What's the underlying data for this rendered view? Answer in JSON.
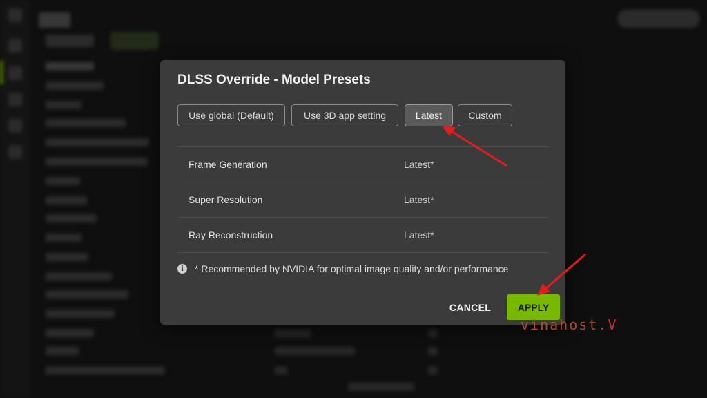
{
  "dialog": {
    "title": "DLSS Override - Model Presets",
    "options": [
      {
        "label": "Use global (Default)",
        "selected": false
      },
      {
        "label": "Use 3D app setting",
        "selected": false
      },
      {
        "label": "Latest",
        "selected": true
      },
      {
        "label": "Custom",
        "selected": false
      }
    ],
    "rows": [
      {
        "name": "Frame Generation",
        "value": "Latest*"
      },
      {
        "name": "Super Resolution",
        "value": "Latest*"
      },
      {
        "name": "Ray Reconstruction",
        "value": "Latest*"
      }
    ],
    "note": "* Recommended by NVIDIA for optimal image quality and/or performance",
    "info_icon": "i",
    "cancel_label": "CANCEL",
    "apply_label": "APPLY"
  },
  "colors": {
    "accent": "#76b900",
    "arrow": "#e01e1e",
    "dialog_bg": "#3b3b3b"
  },
  "watermark": "vinahost"
}
